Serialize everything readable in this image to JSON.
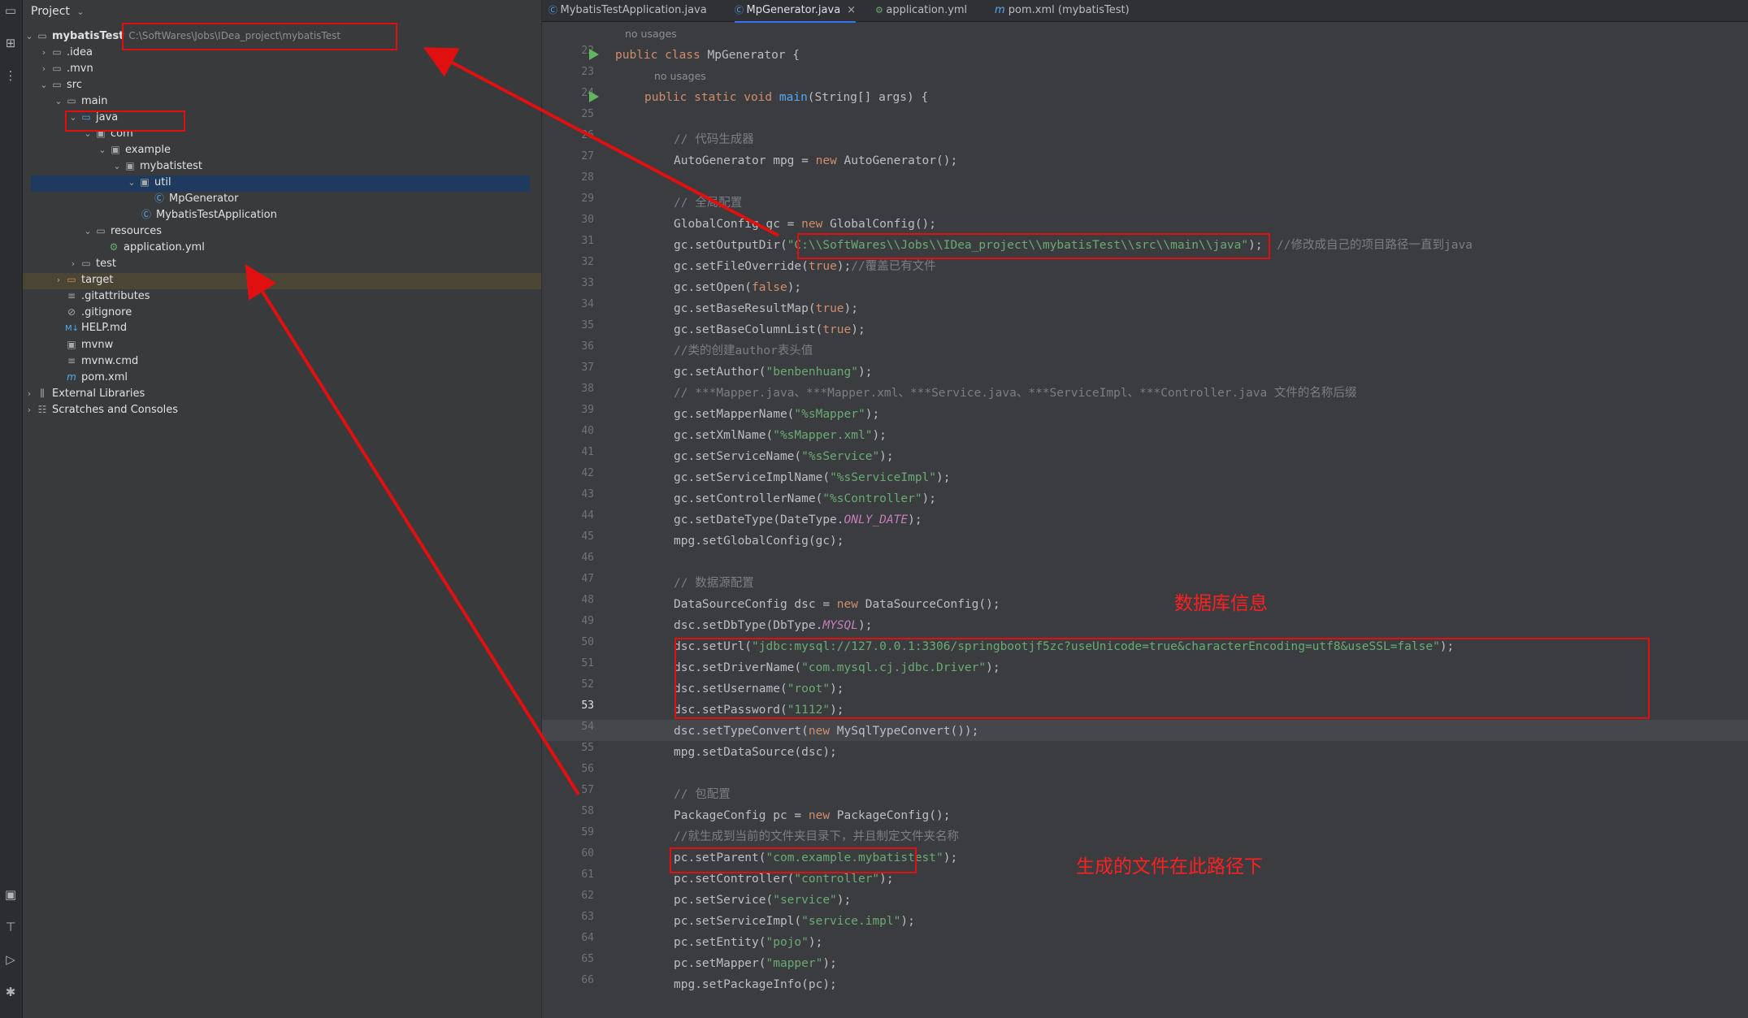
{
  "project_panel": {
    "title": "Project",
    "root": {
      "name": "mybatisTest",
      "path": "C:\\SoftWares\\Jobs\\IDea_project\\mybatisTest"
    },
    "items": [
      {
        "label": ".idea"
      },
      {
        "label": ".mvn"
      },
      {
        "label": "src"
      },
      {
        "label": "main"
      },
      {
        "label": "java"
      },
      {
        "label": "com"
      },
      {
        "label": "example"
      },
      {
        "label": "mybatistest"
      },
      {
        "label": "util"
      },
      {
        "label": "MpGenerator"
      },
      {
        "label": "MybatisTestApplication"
      },
      {
        "label": "resources"
      },
      {
        "label": "application.yml"
      },
      {
        "label": "test"
      },
      {
        "label": "target"
      },
      {
        "label": ".gitattributes"
      },
      {
        "label": ".gitignore"
      },
      {
        "label": "HELP.md"
      },
      {
        "label": "mvnw"
      },
      {
        "label": "mvnw.cmd"
      },
      {
        "label": "pom.xml"
      },
      {
        "label": "External Libraries"
      },
      {
        "label": "Scratches and Consoles"
      }
    ]
  },
  "tabs": [
    {
      "label": "MybatisTestApplication.java"
    },
    {
      "label": "MpGenerator.java"
    },
    {
      "label": "application.yml"
    },
    {
      "label": "pom.xml (mybatisTest)"
    }
  ],
  "hints": {
    "no_usages": "no usages"
  },
  "line_numbers": [
    "22",
    "23",
    "24",
    "25",
    "26",
    "27",
    "28",
    "29",
    "30",
    "31",
    "32",
    "33",
    "34",
    "35",
    "36",
    "37",
    "38",
    "39",
    "40",
    "41",
    "42",
    "43",
    "44",
    "45",
    "46",
    "47",
    "48",
    "49",
    "50",
    "51",
    "52",
    "53",
    "54",
    "55",
    "56",
    "57",
    "58",
    "59",
    "60",
    "61",
    "62",
    "63",
    "64",
    "65",
    "66"
  ],
  "code": {
    "l22": {
      "a": "public class ",
      "b": "MpGenerator {"
    },
    "l23": {
      "a": "public static void ",
      "b": "main",
      "c": "(String[] args) {"
    },
    "l25": "// 代码生成器",
    "l26": {
      "a": "AutoGenerator mpg = ",
      "b": "new ",
      "c": "AutoGenerator();"
    },
    "l28": "// 全局配置",
    "l29": {
      "a": "GlobalConfig gc = ",
      "b": "new ",
      "c": "GlobalConfig();"
    },
    "l30": {
      "a": "gc.setOutputDir(",
      "b": "\"C:\\\\SoftWares\\\\Jobs\\\\IDea_project\\\\mybatisTest\\\\src\\\\main\\\\java\"",
      "c": ");  ",
      "d": "//修改成自己的项目路径一直到java"
    },
    "l31": {
      "a": "gc.setFileOverride(",
      "b": "true",
      "c": ");",
      "d": "//覆盖已有文件"
    },
    "l32": {
      "a": "gc.setOpen(",
      "b": "false",
      "c": ");"
    },
    "l33": {
      "a": "gc.setBaseResultMap(",
      "b": "true",
      "c": ");"
    },
    "l34": {
      "a": "gc.setBaseColumnList(",
      "b": "true",
      "c": ");"
    },
    "l35": "//类的创建author表头值",
    "l36": {
      "a": "gc.setAuthor(",
      "b": "\"benbenhuang\"",
      "c": ");"
    },
    "l37": "// ***Mapper.java、***Mapper.xml、***Service.java、***ServiceImpl、***Controller.java 文件的名称后缀",
    "l38": {
      "a": "gc.setMapperName(",
      "b": "\"%sMapper\"",
      "c": ");"
    },
    "l39": {
      "a": "gc.setXmlName(",
      "b": "\"%sMapper.xml\"",
      "c": ");"
    },
    "l40": {
      "a": "gc.setServiceName(",
      "b": "\"%sService\"",
      "c": ");"
    },
    "l41": {
      "a": "gc.setServiceImplName(",
      "b": "\"%sServiceImpl\"",
      "c": ");"
    },
    "l42": {
      "a": "gc.setControllerName(",
      "b": "\"%sController\"",
      "c": ");"
    },
    "l43": {
      "a": "gc.setDateType(DateType.",
      "b": "ONLY_DATE",
      "c": ");"
    },
    "l44": "mpg.setGlobalConfig(gc);",
    "l46": "// 数据源配置",
    "l47": {
      "a": "DataSourceConfig dsc = ",
      "b": "new ",
      "c": "DataSourceConfig();"
    },
    "l48": {
      "a": "dsc.setDbType(DbType.",
      "b": "MYSQL",
      "c": ");"
    },
    "l49": {
      "a": "dsc.setUrl(",
      "b": "\"jdbc:mysql://127.0.0.1:3306/springbootjf5zc?useUnicode=true&characterEncoding=utf8&useSSL=false\"",
      "c": ");"
    },
    "l50": {
      "a": "dsc.setDriverName(",
      "b": "\"com.mysql.cj.jdbc.Driver\"",
      "c": ");"
    },
    "l51": {
      "a": "dsc.setUsername(",
      "b": "\"root\"",
      "c": ");"
    },
    "l52": {
      "a": "dsc.setPassword(",
      "b": "\"1112\"",
      "c": ");"
    },
    "l53": {
      "a": "dsc.setTypeConvert(",
      "b": "new ",
      "c": "MySqlTypeConvert());"
    },
    "l54": "mpg.setDataSource(dsc);",
    "l56": "// 包配置",
    "l57": {
      "a": "PackageConfig pc = ",
      "b": "new ",
      "c": "PackageConfig();"
    },
    "l58": "//就生成到当前的文件夹目录下，并且制定文件夹名称",
    "l59": {
      "a": "pc.setParent(",
      "b": "\"com.example.mybatistest\"",
      "c": ");"
    },
    "l60": {
      "a": "pc.setController(",
      "b": "\"controller\"",
      "c": ");"
    },
    "l61": {
      "a": "pc.setService(",
      "b": "\"service\"",
      "c": ");"
    },
    "l62": {
      "a": "pc.setServiceImpl(",
      "b": "\"service.impl\"",
      "c": ");"
    },
    "l63": {
      "a": "pc.setEntity(",
      "b": "\"pojo\"",
      "c": ");"
    },
    "l64": {
      "a": "pc.setMapper(",
      "b": "\"mapper\"",
      "c": ");"
    },
    "l65": "mpg.setPackageInfo(pc);"
  },
  "annotations": {
    "db_info": "数据库信息",
    "output_path": "生成的文件在此路径下"
  },
  "colors": {
    "annotation_red": "#ff2020",
    "keyword": "#cf8e6d",
    "string": "#6aab73",
    "comment": "#7a7e85"
  }
}
